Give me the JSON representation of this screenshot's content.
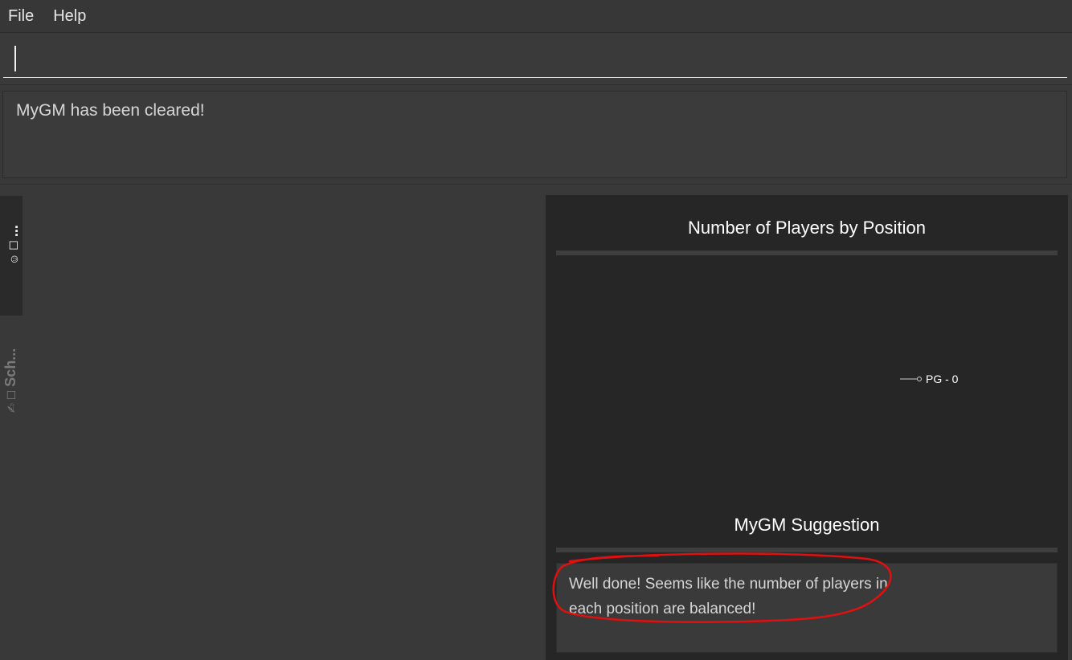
{
  "menu": {
    "items": [
      {
        "label": "File"
      },
      {
        "label": "Help"
      }
    ]
  },
  "command": {
    "value": "",
    "placeholder": ""
  },
  "result": {
    "text": "MyGM has been cleared!"
  },
  "side_tabs": {
    "active_label": "...",
    "inactive_label": "Sch..."
  },
  "stats": {
    "chart_title": "Number of Players by Position",
    "suggestion_title": "MyGM Suggestion",
    "suggestion_text": "Well done! Seems like the number of players in each position are balanced!"
  },
  "chart_data": {
    "type": "pie",
    "title": "Number of Players by Position",
    "slices": [
      {
        "label": "PG - 0",
        "value": 0
      }
    ],
    "legend": "none"
  },
  "annotation": {
    "color": "#e01010"
  }
}
